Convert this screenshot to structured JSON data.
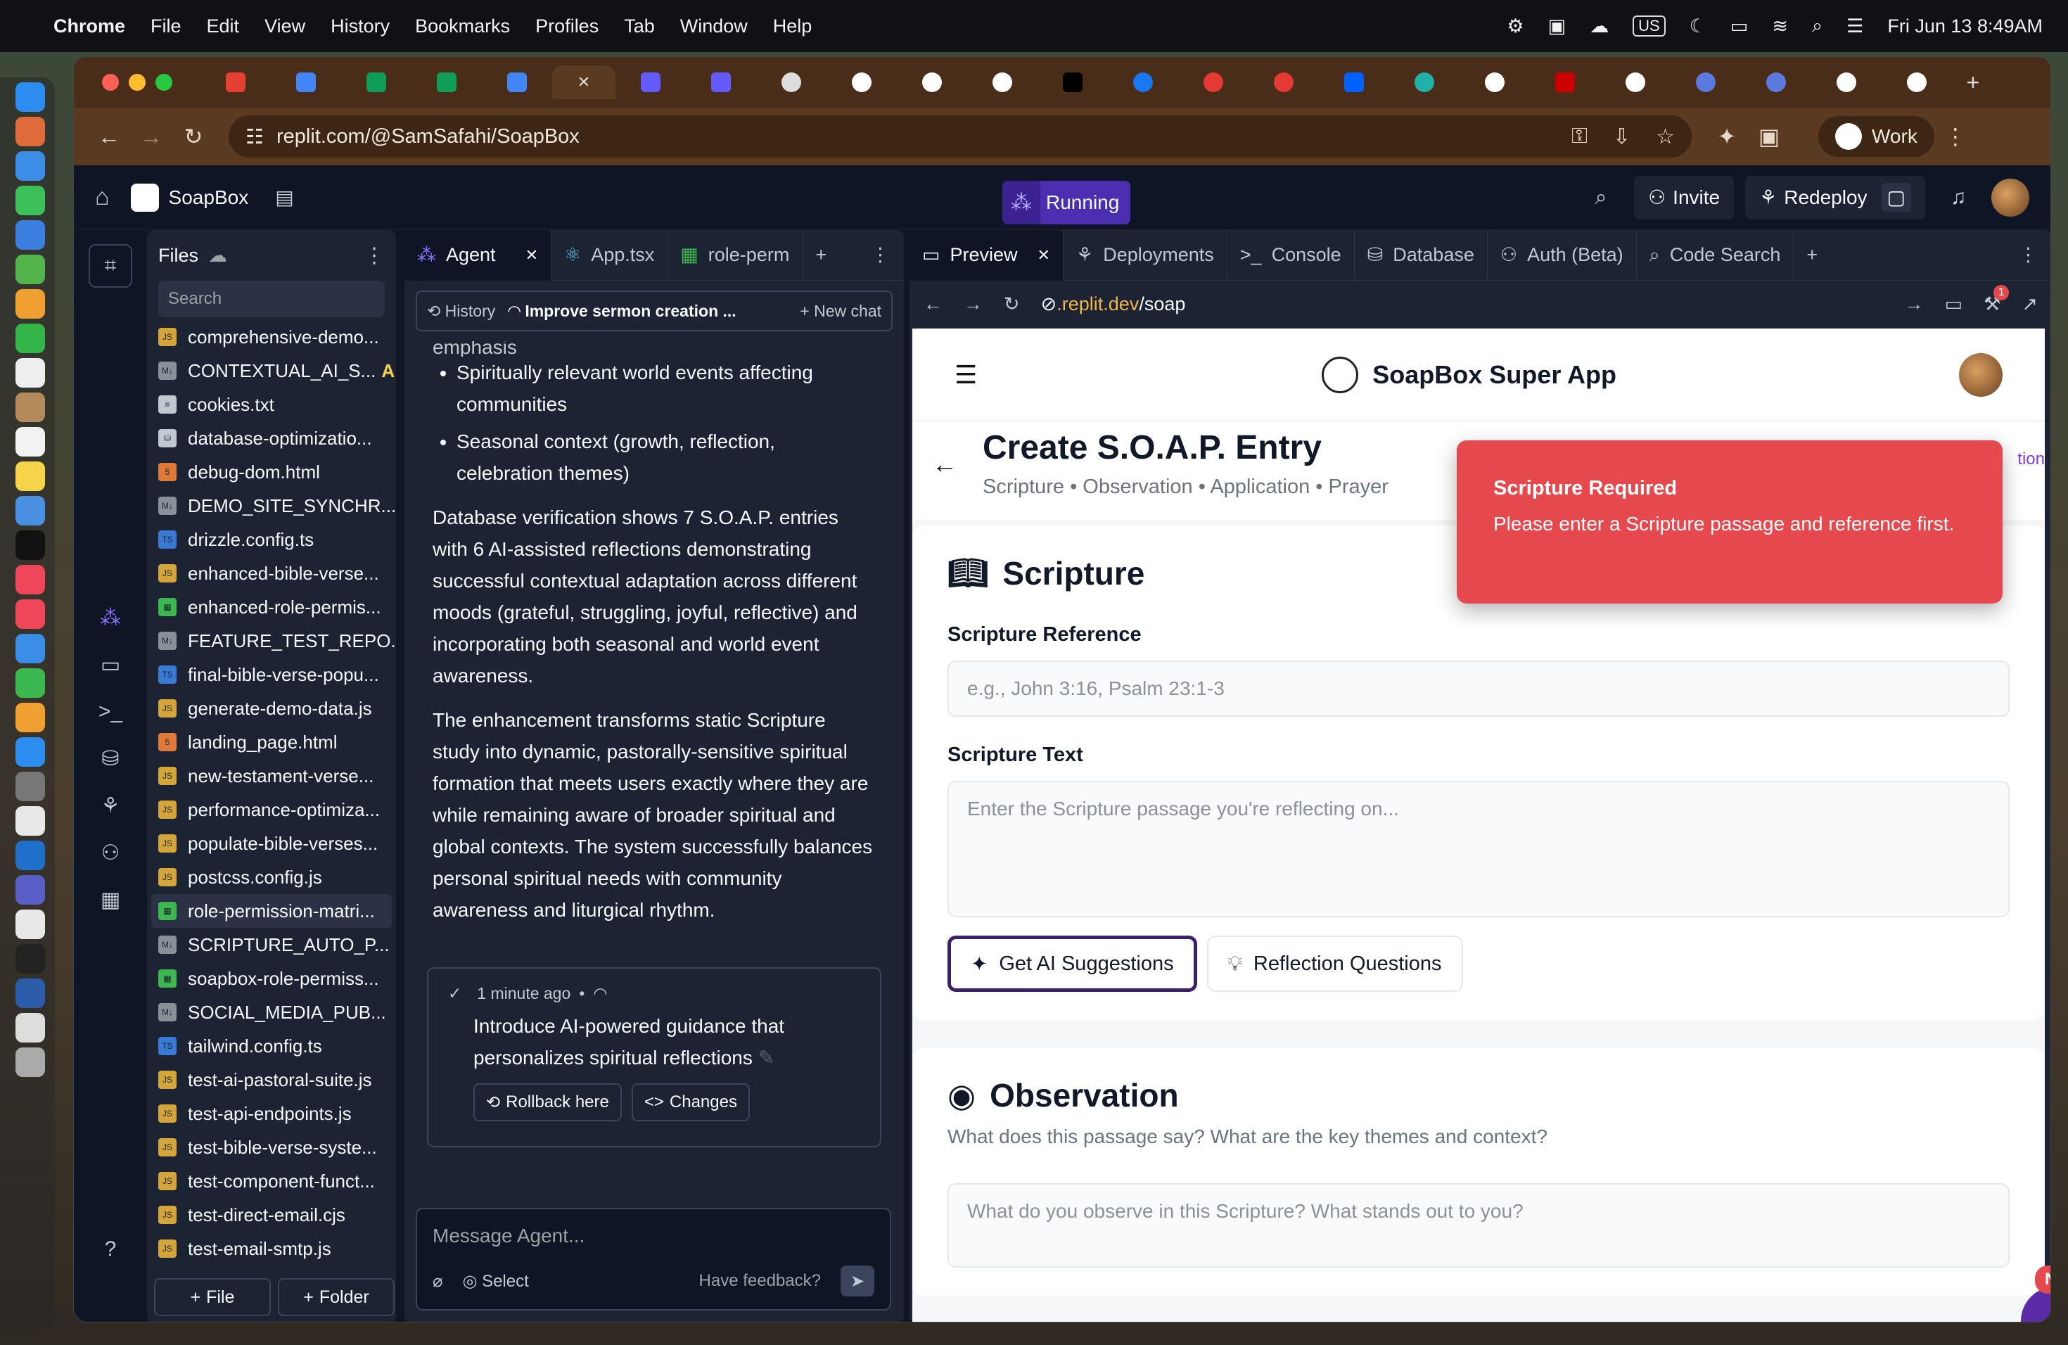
{
  "menubar": {
    "app": "Chrome",
    "items": [
      "File",
      "Edit",
      "View",
      "History",
      "Bookmarks",
      "Profiles",
      "Tab",
      "Window",
      "Help"
    ],
    "input_source": "US",
    "datetime": "Fri Jun 13  8:49AM"
  },
  "browser": {
    "url": "replit.com/@SamSafahi/SoapBox",
    "profile_label": "Work",
    "tab_count_hint": "tabs"
  },
  "replit": {
    "project": "SoapBox",
    "running_label": "Running",
    "invite_label": "Invite",
    "redeploy_label": "Redeploy"
  },
  "files": {
    "title": "Files",
    "search_placeholder": "Search",
    "items": [
      {
        "name": "comprehensive-demo...",
        "type": "js"
      },
      {
        "name": "CONTEXTUAL_AI_S...",
        "type": "md",
        "badge": "A"
      },
      {
        "name": "cookies.txt",
        "type": "txt"
      },
      {
        "name": "database-optimizatio...",
        "type": "db"
      },
      {
        "name": "debug-dom.html",
        "type": "html"
      },
      {
        "name": "DEMO_SITE_SYNCHR...",
        "type": "md"
      },
      {
        "name": "drizzle.config.ts",
        "type": "ts"
      },
      {
        "name": "enhanced-bible-verse...",
        "type": "js"
      },
      {
        "name": "enhanced-role-permis...",
        "type": "sheet"
      },
      {
        "name": "FEATURE_TEST_REPO...",
        "type": "md"
      },
      {
        "name": "final-bible-verse-popu...",
        "type": "ts"
      },
      {
        "name": "generate-demo-data.js",
        "type": "js"
      },
      {
        "name": "landing_page.html",
        "type": "html"
      },
      {
        "name": "new-testament-verse...",
        "type": "js"
      },
      {
        "name": "performance-optimiza...",
        "type": "js"
      },
      {
        "name": "populate-bible-verses...",
        "type": "js"
      },
      {
        "name": "postcss.config.js",
        "type": "js"
      },
      {
        "name": "role-permission-matri...",
        "type": "sheet",
        "selected": true
      },
      {
        "name": "SCRIPTURE_AUTO_P...",
        "type": "md"
      },
      {
        "name": "soapbox-role-permiss...",
        "type": "sheet"
      },
      {
        "name": "SOCIAL_MEDIA_PUB...",
        "type": "md"
      },
      {
        "name": "tailwind.config.ts",
        "type": "ts"
      },
      {
        "name": "test-ai-pastoral-suite.js",
        "type": "js"
      },
      {
        "name": "test-api-endpoints.js",
        "type": "js"
      },
      {
        "name": "test-bible-verse-syste...",
        "type": "js"
      },
      {
        "name": "test-component-funct...",
        "type": "js"
      },
      {
        "name": "test-direct-email.cjs",
        "type": "js"
      },
      {
        "name": "test-email-smtp.js",
        "type": "js"
      }
    ],
    "new_file": "File",
    "new_folder": "Folder"
  },
  "agent": {
    "tabs": [
      "Agent",
      "App.tsx",
      "role-perm"
    ],
    "history_label": "History",
    "current_chat": "Improve sermon creation ...",
    "new_chat_label": "New chat",
    "fade_text": "emphasis",
    "bullets": [
      "Spiritually relevant world events affecting communities",
      "Seasonal context (growth, reflection, celebration themes)"
    ],
    "paragraphs": [
      "Database verification shows 7 S.O.A.P. entries with 6 AI-assisted reflections demonstrating successful contextual adaptation across different moods (grateful, struggling, joyful, reflective) and incorporating both seasonal and world event awareness.",
      "The enhancement transforms static Scripture study into dynamic, pastorally-sensitive spiritual formation that meets users exactly where they are while remaining aware of broader spiritual and global contexts. The system successfully balances personal spiritual needs with community awareness and liturgical rhythm."
    ],
    "checkpoint": {
      "time": "1 minute ago",
      "message": "Introduce AI-powered guidance that personalizes spiritual reflections",
      "rollback": "Rollback here",
      "changes": "Changes"
    },
    "composer_placeholder": "Message Agent...",
    "select_label": "Select",
    "feedback_label": "Have feedback?"
  },
  "preview": {
    "tabs": [
      "Preview",
      "Deployments",
      "Console",
      "Database",
      "Auth (Beta)",
      "Code Search"
    ],
    "url_domain": ".replit.dev",
    "url_path": "/soap",
    "notif_count": "1"
  },
  "site": {
    "brand": "SoapBox Super App",
    "page_title": "Create S.O.A.P. Entry",
    "page_subtitle": "Scripture • Observation • Application • Prayer",
    "edge_text": "tion",
    "scripture": {
      "heading": "Scripture",
      "ref_label": "Scripture Reference",
      "ref_placeholder": "e.g., John 3:16, Psalm 23:1-3",
      "text_label": "Scripture Text",
      "text_placeholder": "Enter the Scripture passage you're reflecting on...",
      "ai_button": "Get AI Suggestions",
      "questions_button": "Reflection Questions"
    },
    "observation": {
      "heading": "Observation",
      "description": "What does this passage say? What are the key themes and context?",
      "placeholder": "What do you observe in this Scripture? What stands out to you?"
    },
    "toast": {
      "title": "Scripture Required",
      "description": "Please enter a Scripture passage and reference first."
    },
    "new_badge": "New"
  },
  "colors": {
    "replit_bg": "#0e1525",
    "panel_bg": "#1c2333",
    "accent": "#4b2fb0",
    "toast": "#e5484d"
  }
}
